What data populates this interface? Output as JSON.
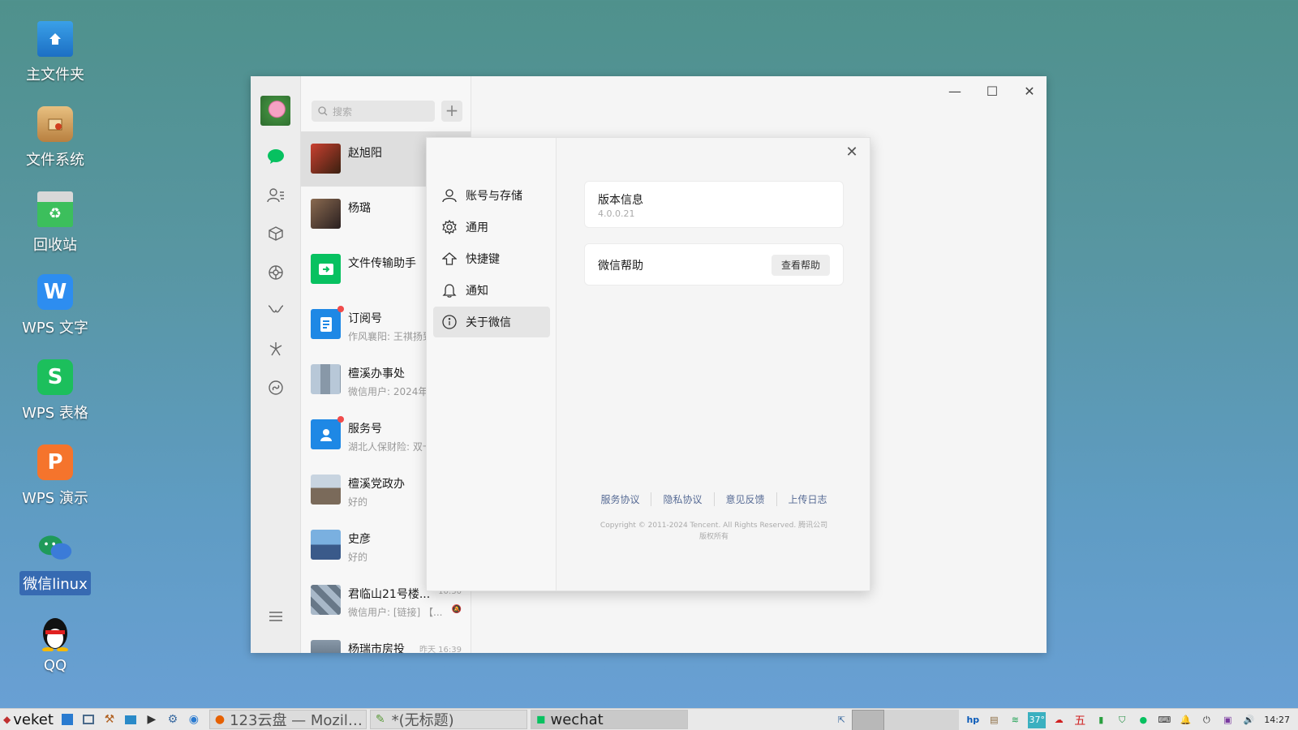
{
  "desktop": {
    "icons": [
      {
        "label": "主文件夹",
        "icon": "home-folder-icon"
      },
      {
        "label": "文件系统",
        "icon": "filesystem-icon"
      },
      {
        "label": "回收站",
        "icon": "trash-icon"
      },
      {
        "label": "WPS 文字",
        "icon": "wps-writer-icon"
      },
      {
        "label": "WPS 表格",
        "icon": "wps-spreadsheet-icon"
      },
      {
        "label": "WPS 演示",
        "icon": "wps-presentation-icon"
      },
      {
        "label": "微信linux",
        "icon": "wechat-icon"
      },
      {
        "label": "QQ",
        "icon": "qq-icon"
      }
    ]
  },
  "wechat": {
    "search_placeholder": "搜索",
    "plus_label": "+",
    "chats": [
      {
        "name": "赵旭阳",
        "preview": "",
        "time": "",
        "avatar_color": "#8a3a2a"
      },
      {
        "name": "杨璐",
        "preview": "",
        "time": "",
        "avatar_color": "#6b5040"
      },
      {
        "name": "文件传输助手",
        "preview": "",
        "time": "",
        "avatar_color": "#07c160"
      },
      {
        "name": "订阅号",
        "preview": "作风襄阳: 王祺扬到",
        "time": "",
        "avatar_color": "#1e88e5"
      },
      {
        "name": "檀溪办事处",
        "preview": "微信用户: 2024年",
        "time": "",
        "avatar_color": "#8aa0b8"
      },
      {
        "name": "服务号",
        "preview": "湖北人保财险: 双十",
        "time": "",
        "avatar_color": "#1e88e5"
      },
      {
        "name": "檀溪党政办",
        "preview": "好的",
        "time": "",
        "avatar_color": "#7a8a9a"
      },
      {
        "name": "史彦",
        "preview": "好的",
        "time": "",
        "avatar_color": "#4a7ab0"
      },
      {
        "name": "君临山21号楼...",
        "preview": "微信用户: [链接] 【...",
        "time": "10:30",
        "avatar_color": "#9aa8b8"
      },
      {
        "name": "杨瑞市房投",
        "preview": "",
        "time": "昨天 16:39",
        "avatar_color": "#708090"
      }
    ],
    "window_controls": {
      "minimize": "—",
      "maximize": "☐",
      "close": "✕"
    }
  },
  "settings": {
    "menu": [
      {
        "label": "账号与存储",
        "icon": "user-icon"
      },
      {
        "label": "通用",
        "icon": "gear-icon"
      },
      {
        "label": "快捷键",
        "icon": "shortcut-icon"
      },
      {
        "label": "通知",
        "icon": "bell-icon"
      },
      {
        "label": "关于微信",
        "icon": "info-icon"
      }
    ],
    "active_menu": "关于微信",
    "close_label": "✕",
    "version_title": "版本信息",
    "version_value": "4.0.0.21",
    "help_title": "微信帮助",
    "help_button": "查看帮助",
    "footer_links": [
      "服务协议",
      "隐私协议",
      "意见反馈",
      "上传日志"
    ],
    "copyright": "Copyright © 2011-2024 Tencent. All Rights Reserved. 腾讯公司 版权所有"
  },
  "taskbar": {
    "start_label": "veket",
    "tasks": [
      {
        "label": "123云盘 — Mozil…",
        "active": false
      },
      {
        "label": "*(无标题)",
        "active": false
      },
      {
        "label": "wechat",
        "active": true
      }
    ],
    "temperature": "37°",
    "clock": "14:27"
  },
  "colors": {
    "accent_green": "#07c160",
    "link_blue": "#576b95",
    "unread_red": "#f04b4b"
  }
}
